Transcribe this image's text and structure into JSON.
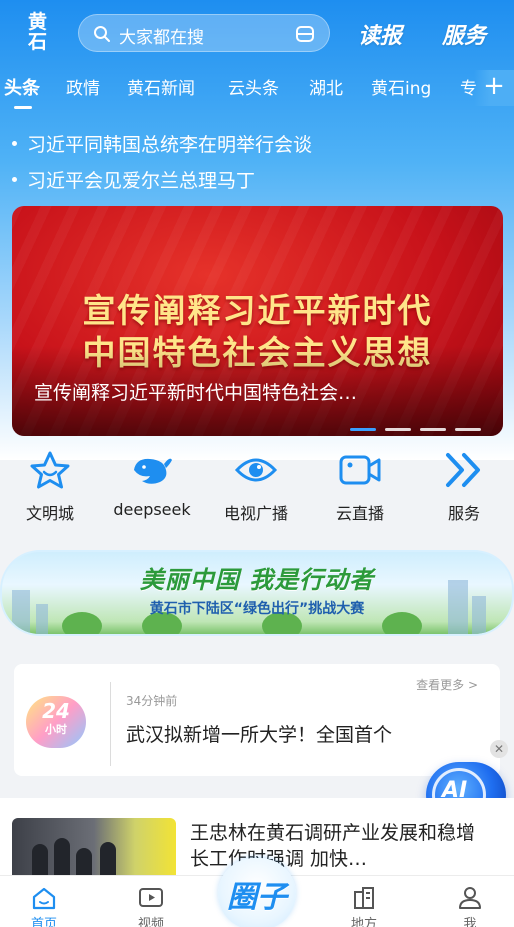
{
  "header": {
    "logo_line1": "黄",
    "logo_line2": "石",
    "search_placeholder": "大家都在搜",
    "read_paper": "读报",
    "service": "服务"
  },
  "tabs": [
    "头条",
    "政情",
    "黄石新闻",
    "云头条",
    "湖北",
    "黄石ing",
    "专"
  ],
  "headlines": [
    "习近平同韩国总统李在明举行会谈",
    "习近平会见爱尔兰总理马丁"
  ],
  "banner": {
    "line1": "宣传阐释习近平新时代",
    "line2": "中国特色社会主义思想",
    "caption": "宣传阐释习近平新时代中国特色社会…",
    "slide_count": 4,
    "active_slide": 1
  },
  "entries": [
    {
      "label": "文明城",
      "icon": "star-icon"
    },
    {
      "label": "deepseek",
      "icon": "whale-icon"
    },
    {
      "label": "电视广播",
      "icon": "eye-icon"
    },
    {
      "label": "云直播",
      "icon": "video-camera-icon"
    },
    {
      "label": "服务",
      "icon": "double-chevron-right-icon"
    }
  ],
  "promo": {
    "title": "美丽中国 我是行动者",
    "subtitle": "黄石市下陆区“绿色出行”挑战大赛"
  },
  "news_card": {
    "badge_number": "24",
    "badge_unit": "小时",
    "time": "34分钟前",
    "more": "查看更多 >",
    "title": "武汉拟新增一所大学！全国首个"
  },
  "ai_button": "AI",
  "article": {
    "title": "王忠林在黄石调研产业发展和稳增长工作时强调 加快…"
  },
  "bottom_nav": {
    "home": "首页",
    "video": "视频",
    "circle": "圈子",
    "local": "地方",
    "me": "我"
  },
  "colors": {
    "brand_blue": "#1e8ef0",
    "banner_red": "#c8121a",
    "banner_text_gold": "#ffe58a"
  }
}
